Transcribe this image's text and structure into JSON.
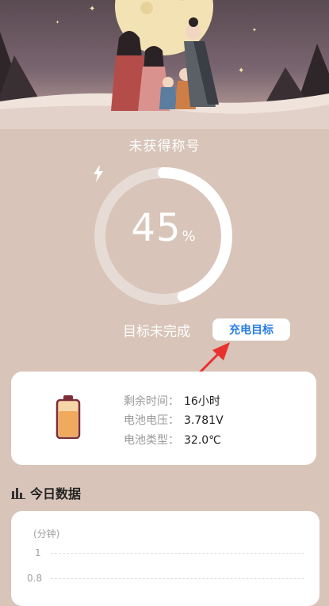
{
  "title": "未获得称号",
  "progress": {
    "value": 45,
    "percent_label": "45",
    "percent_sign": "%"
  },
  "goal": {
    "status_text": "目标未完成",
    "button_label": "充电目标"
  },
  "info": {
    "remaining_label": "剩余时间：",
    "remaining_value": "16小时",
    "voltage_label": "电池电压：",
    "voltage_value": "3.781V",
    "type_label": "电池类型：",
    "type_value": "32.0℃"
  },
  "today": {
    "section_title": "今日数据",
    "unit_label": "(分钟)",
    "ticks": [
      "1",
      "0.8"
    ]
  },
  "colors": {
    "background": "#d8c4b8",
    "accent": "#2a7de1",
    "annotation_arrow": "#e8322f"
  }
}
